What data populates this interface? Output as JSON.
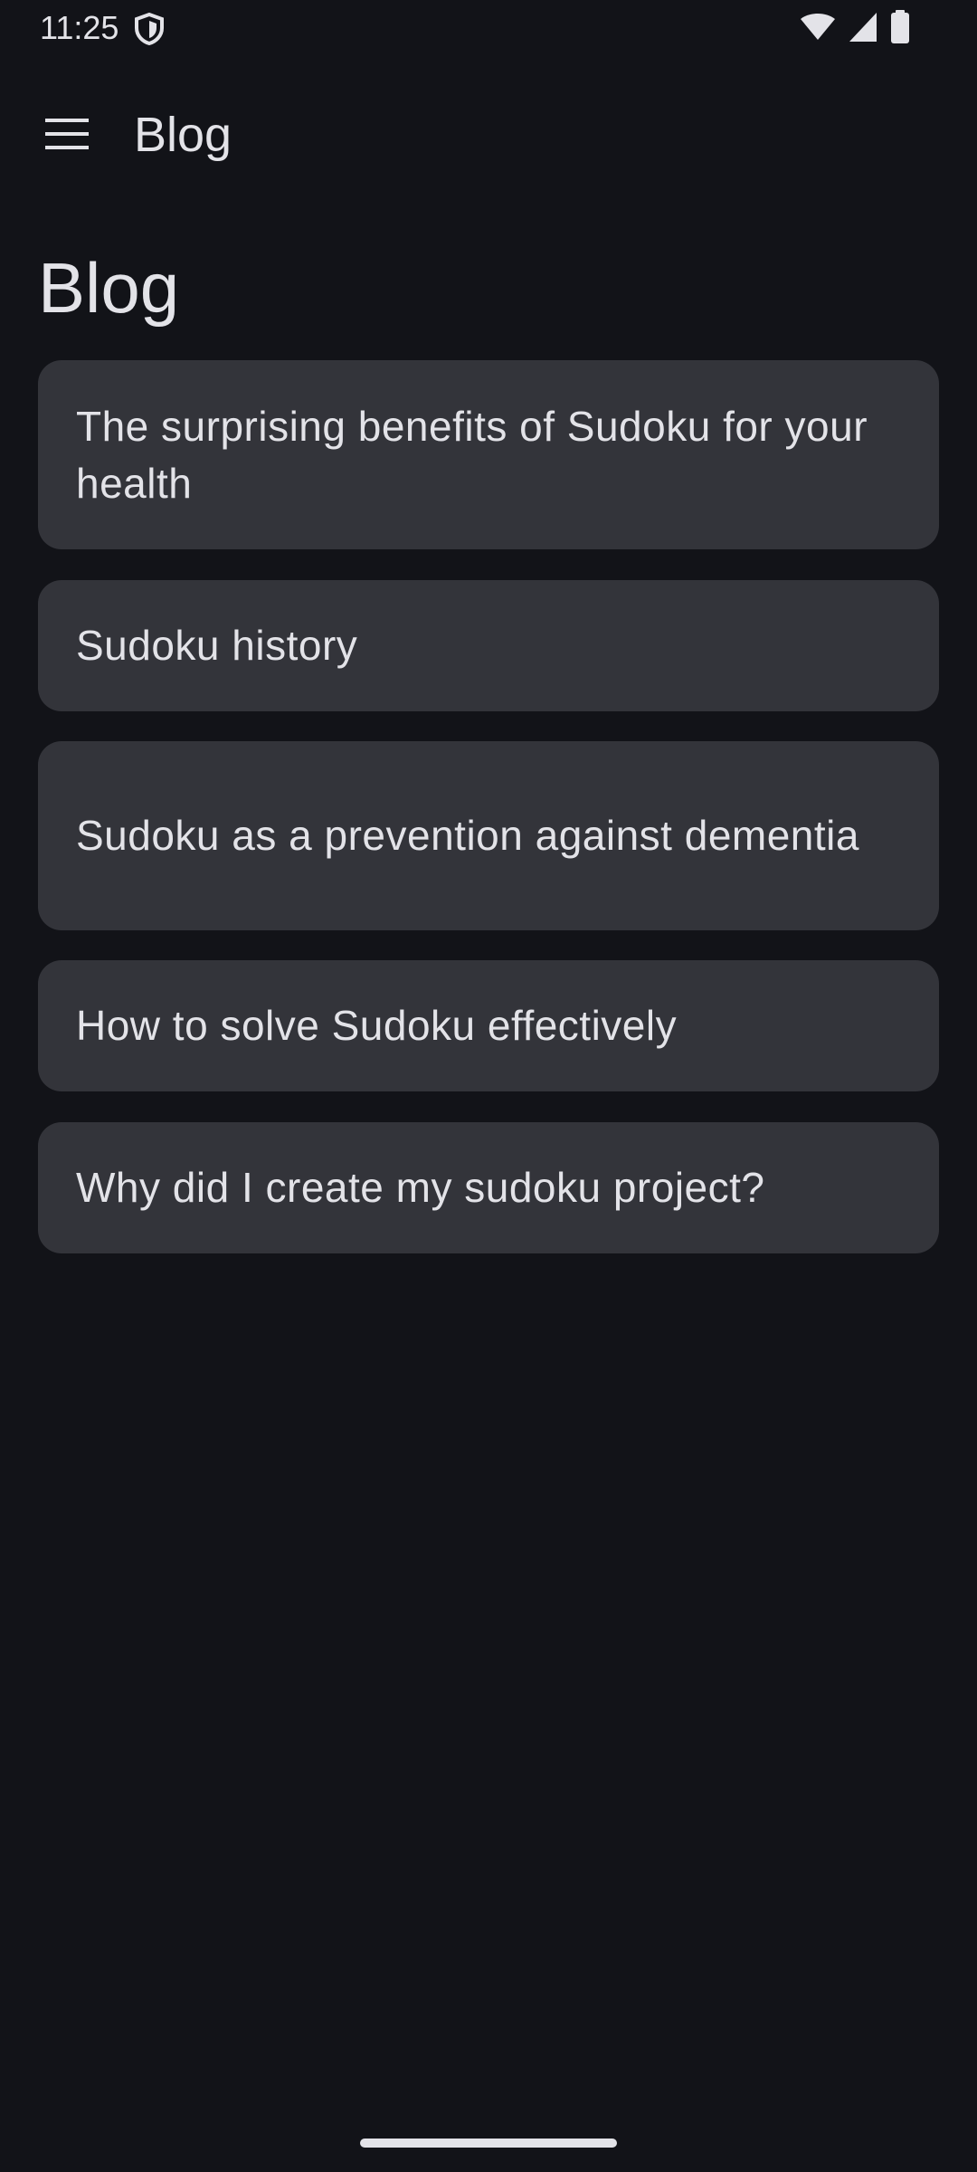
{
  "status_bar": {
    "time": "11:25",
    "icons": [
      "shield-icon",
      "wifi-icon",
      "cellular-signal-icon",
      "battery-icon"
    ]
  },
  "app_bar": {
    "menu_icon": "hamburger-menu-icon",
    "title": "Blog"
  },
  "page": {
    "heading": "Blog"
  },
  "posts": [
    {
      "title": "The surprising benefits of Sudoku for your health"
    },
    {
      "title": "Sudoku history"
    },
    {
      "title": "Sudoku as a prevention against dementia"
    },
    {
      "title": "How to solve Sudoku effectively"
    },
    {
      "title": "Why did I create my sudoku project?"
    }
  ],
  "colors": {
    "background": "#121318",
    "card": "#33343a",
    "text": "#e3e3e8"
  }
}
